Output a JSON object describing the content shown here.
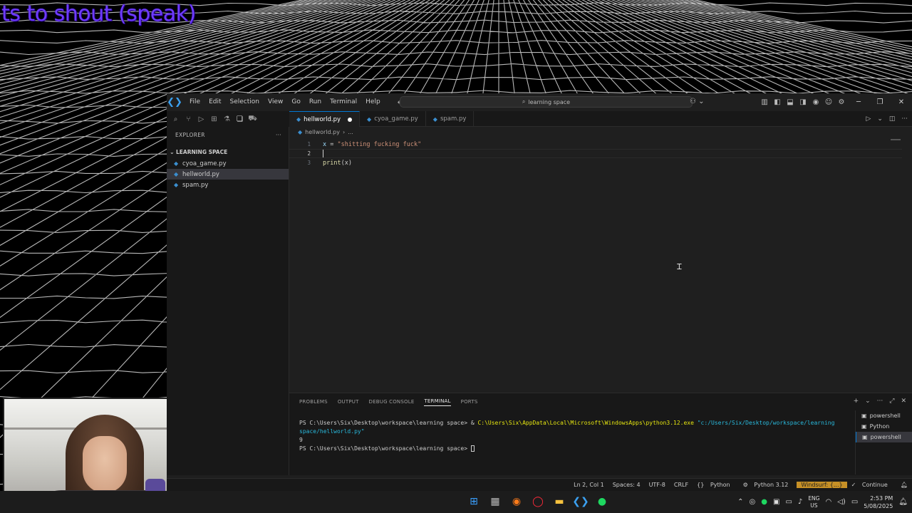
{
  "overlay": {
    "caption": "ts to shout (speak)"
  },
  "window": {
    "menu": [
      "File",
      "Edit",
      "Selection",
      "View",
      "Go",
      "Run",
      "Terminal",
      "Help"
    ],
    "search": "learning space"
  },
  "explorer": {
    "header": "EXPLORER",
    "section": "LEARNING SPACE",
    "files": [
      "cyoa_game.py",
      "hellworld.py",
      "spam.py"
    ],
    "selected_file": "hellworld.py"
  },
  "tabs": [
    {
      "label": "hellworld.py",
      "active": true,
      "modified": true
    },
    {
      "label": "cyoa_game.py",
      "active": false
    },
    {
      "label": "spam.py",
      "active": false
    }
  ],
  "breadcrumb": {
    "file": "hellworld.py",
    "rest": "..."
  },
  "editor": {
    "lines": [
      {
        "num": "1",
        "var": "x",
        "op": " = ",
        "str": "\"shitting fucking fuck\""
      },
      {
        "num": "2"
      },
      {
        "num": "3",
        "fn": "print",
        "args": "(x)"
      }
    ]
  },
  "panel": {
    "tabs": [
      "PROBLEMS",
      "OUTPUT",
      "DEBUG CONSOLE",
      "TERMINAL",
      "PORTS"
    ],
    "active_tab": "TERMINAL",
    "terminal": {
      "prompt": "PS C:\\Users\\Six\\Desktop\\workspace\\learning space>",
      "cmd_amp": " & ",
      "cmd_exe": "C:\\Users\\Six\\AppData\\Local\\Microsoft\\WindowsApps\\python3.12.exe",
      "cmd_arg_1": " \"c:/Users/Six/Desktop/workspace/learning",
      "cmd_arg_2": " space/hellworld.py\"",
      "output": "9",
      "prompt2": "PS C:\\Users\\Six\\Desktop\\workspace\\learning space>"
    },
    "terminals": [
      "powershell",
      "Python",
      "powershell"
    ]
  },
  "statusbar": {
    "position": "Ln 2, Col 1",
    "spaces": "Spaces: 4",
    "encoding": "UTF-8",
    "eol": "CRLF",
    "language": "Python",
    "interpreter": "Python 3.12",
    "windsurf": "Windsurf: {...}",
    "continue": "Continue"
  },
  "taskbar": {
    "lang_top": "ENG",
    "lang_bottom": "US",
    "time": "2:53 PM",
    "date": "5/08/2025"
  }
}
